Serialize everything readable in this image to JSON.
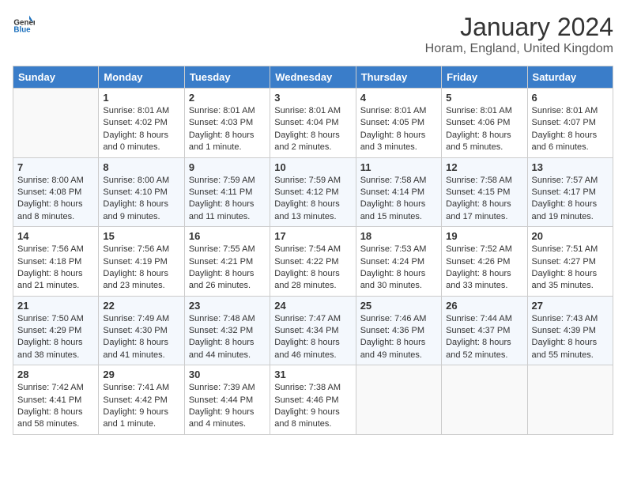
{
  "header": {
    "logo_general": "General",
    "logo_blue": "Blue",
    "title": "January 2024",
    "subtitle": "Horam, England, United Kingdom"
  },
  "weekdays": [
    "Sunday",
    "Monday",
    "Tuesday",
    "Wednesday",
    "Thursday",
    "Friday",
    "Saturday"
  ],
  "weeks": [
    [
      {
        "day": "",
        "info": ""
      },
      {
        "day": "1",
        "info": "Sunrise: 8:01 AM\nSunset: 4:02 PM\nDaylight: 8 hours\nand 0 minutes."
      },
      {
        "day": "2",
        "info": "Sunrise: 8:01 AM\nSunset: 4:03 PM\nDaylight: 8 hours\nand 1 minute."
      },
      {
        "day": "3",
        "info": "Sunrise: 8:01 AM\nSunset: 4:04 PM\nDaylight: 8 hours\nand 2 minutes."
      },
      {
        "day": "4",
        "info": "Sunrise: 8:01 AM\nSunset: 4:05 PM\nDaylight: 8 hours\nand 3 minutes."
      },
      {
        "day": "5",
        "info": "Sunrise: 8:01 AM\nSunset: 4:06 PM\nDaylight: 8 hours\nand 5 minutes."
      },
      {
        "day": "6",
        "info": "Sunrise: 8:01 AM\nSunset: 4:07 PM\nDaylight: 8 hours\nand 6 minutes."
      }
    ],
    [
      {
        "day": "7",
        "info": "Sunrise: 8:00 AM\nSunset: 4:08 PM\nDaylight: 8 hours\nand 8 minutes."
      },
      {
        "day": "8",
        "info": "Sunrise: 8:00 AM\nSunset: 4:10 PM\nDaylight: 8 hours\nand 9 minutes."
      },
      {
        "day": "9",
        "info": "Sunrise: 7:59 AM\nSunset: 4:11 PM\nDaylight: 8 hours\nand 11 minutes."
      },
      {
        "day": "10",
        "info": "Sunrise: 7:59 AM\nSunset: 4:12 PM\nDaylight: 8 hours\nand 13 minutes."
      },
      {
        "day": "11",
        "info": "Sunrise: 7:58 AM\nSunset: 4:14 PM\nDaylight: 8 hours\nand 15 minutes."
      },
      {
        "day": "12",
        "info": "Sunrise: 7:58 AM\nSunset: 4:15 PM\nDaylight: 8 hours\nand 17 minutes."
      },
      {
        "day": "13",
        "info": "Sunrise: 7:57 AM\nSunset: 4:17 PM\nDaylight: 8 hours\nand 19 minutes."
      }
    ],
    [
      {
        "day": "14",
        "info": "Sunrise: 7:56 AM\nSunset: 4:18 PM\nDaylight: 8 hours\nand 21 minutes."
      },
      {
        "day": "15",
        "info": "Sunrise: 7:56 AM\nSunset: 4:19 PM\nDaylight: 8 hours\nand 23 minutes."
      },
      {
        "day": "16",
        "info": "Sunrise: 7:55 AM\nSunset: 4:21 PM\nDaylight: 8 hours\nand 26 minutes."
      },
      {
        "day": "17",
        "info": "Sunrise: 7:54 AM\nSunset: 4:22 PM\nDaylight: 8 hours\nand 28 minutes."
      },
      {
        "day": "18",
        "info": "Sunrise: 7:53 AM\nSunset: 4:24 PM\nDaylight: 8 hours\nand 30 minutes."
      },
      {
        "day": "19",
        "info": "Sunrise: 7:52 AM\nSunset: 4:26 PM\nDaylight: 8 hours\nand 33 minutes."
      },
      {
        "day": "20",
        "info": "Sunrise: 7:51 AM\nSunset: 4:27 PM\nDaylight: 8 hours\nand 35 minutes."
      }
    ],
    [
      {
        "day": "21",
        "info": "Sunrise: 7:50 AM\nSunset: 4:29 PM\nDaylight: 8 hours\nand 38 minutes."
      },
      {
        "day": "22",
        "info": "Sunrise: 7:49 AM\nSunset: 4:30 PM\nDaylight: 8 hours\nand 41 minutes."
      },
      {
        "day": "23",
        "info": "Sunrise: 7:48 AM\nSunset: 4:32 PM\nDaylight: 8 hours\nand 44 minutes."
      },
      {
        "day": "24",
        "info": "Sunrise: 7:47 AM\nSunset: 4:34 PM\nDaylight: 8 hours\nand 46 minutes."
      },
      {
        "day": "25",
        "info": "Sunrise: 7:46 AM\nSunset: 4:36 PM\nDaylight: 8 hours\nand 49 minutes."
      },
      {
        "day": "26",
        "info": "Sunrise: 7:44 AM\nSunset: 4:37 PM\nDaylight: 8 hours\nand 52 minutes."
      },
      {
        "day": "27",
        "info": "Sunrise: 7:43 AM\nSunset: 4:39 PM\nDaylight: 8 hours\nand 55 minutes."
      }
    ],
    [
      {
        "day": "28",
        "info": "Sunrise: 7:42 AM\nSunset: 4:41 PM\nDaylight: 8 hours\nand 58 minutes."
      },
      {
        "day": "29",
        "info": "Sunrise: 7:41 AM\nSunset: 4:42 PM\nDaylight: 9 hours\nand 1 minute."
      },
      {
        "day": "30",
        "info": "Sunrise: 7:39 AM\nSunset: 4:44 PM\nDaylight: 9 hours\nand 4 minutes."
      },
      {
        "day": "31",
        "info": "Sunrise: 7:38 AM\nSunset: 4:46 PM\nDaylight: 9 hours\nand 8 minutes."
      },
      {
        "day": "",
        "info": ""
      },
      {
        "day": "",
        "info": ""
      },
      {
        "day": "",
        "info": ""
      }
    ]
  ]
}
